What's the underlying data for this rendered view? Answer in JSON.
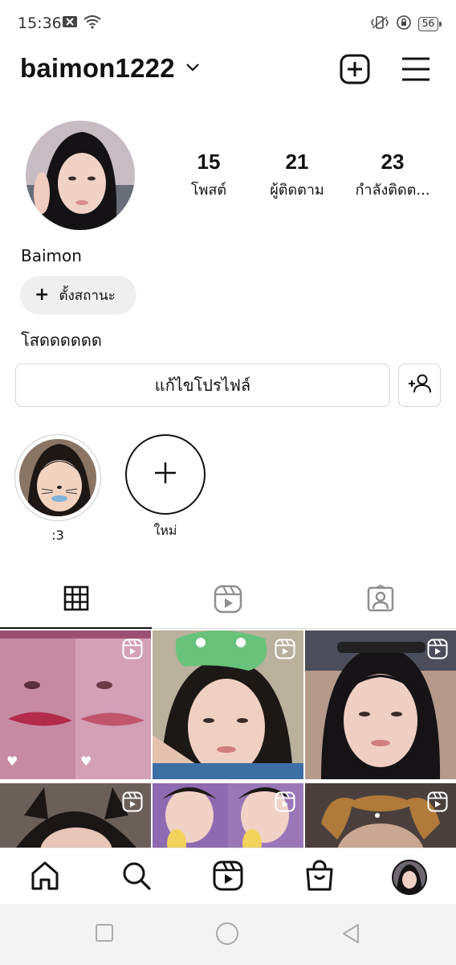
{
  "status_bar": {
    "time": "15:36",
    "battery": "56",
    "icons": [
      "message-icon",
      "wifi-icon",
      "vibrate-icon",
      "rotation-lock-icon",
      "battery-icon"
    ]
  },
  "header": {
    "username": "baimon1222",
    "icons": [
      "chevron-down-icon",
      "add-post-icon",
      "menu-icon"
    ]
  },
  "profile": {
    "stats": [
      {
        "value": "15",
        "label": "โพสต์"
      },
      {
        "value": "21",
        "label": "ผู้ติดตาม"
      },
      {
        "value": "23",
        "label": "กำลังติดต..."
      }
    ],
    "display_name": "Baimon",
    "status_chip_label": "ตั้งสถานะ",
    "bio": "โสดดดดดด",
    "edit_profile_label": "แก้ไขโปรไฟล์"
  },
  "highlights": [
    {
      "label": ":3"
    },
    {
      "label": "ใหม่"
    }
  ],
  "tabs": [
    "grid-icon",
    "reels-icon",
    "tagged-icon"
  ],
  "bottom_nav": [
    "home-icon",
    "search-icon",
    "reels-icon",
    "shop-icon",
    "profile-avatar"
  ],
  "colors": {
    "accent": "#111111",
    "chip_bg": "#efefef",
    "border": "#d6d6d6"
  }
}
